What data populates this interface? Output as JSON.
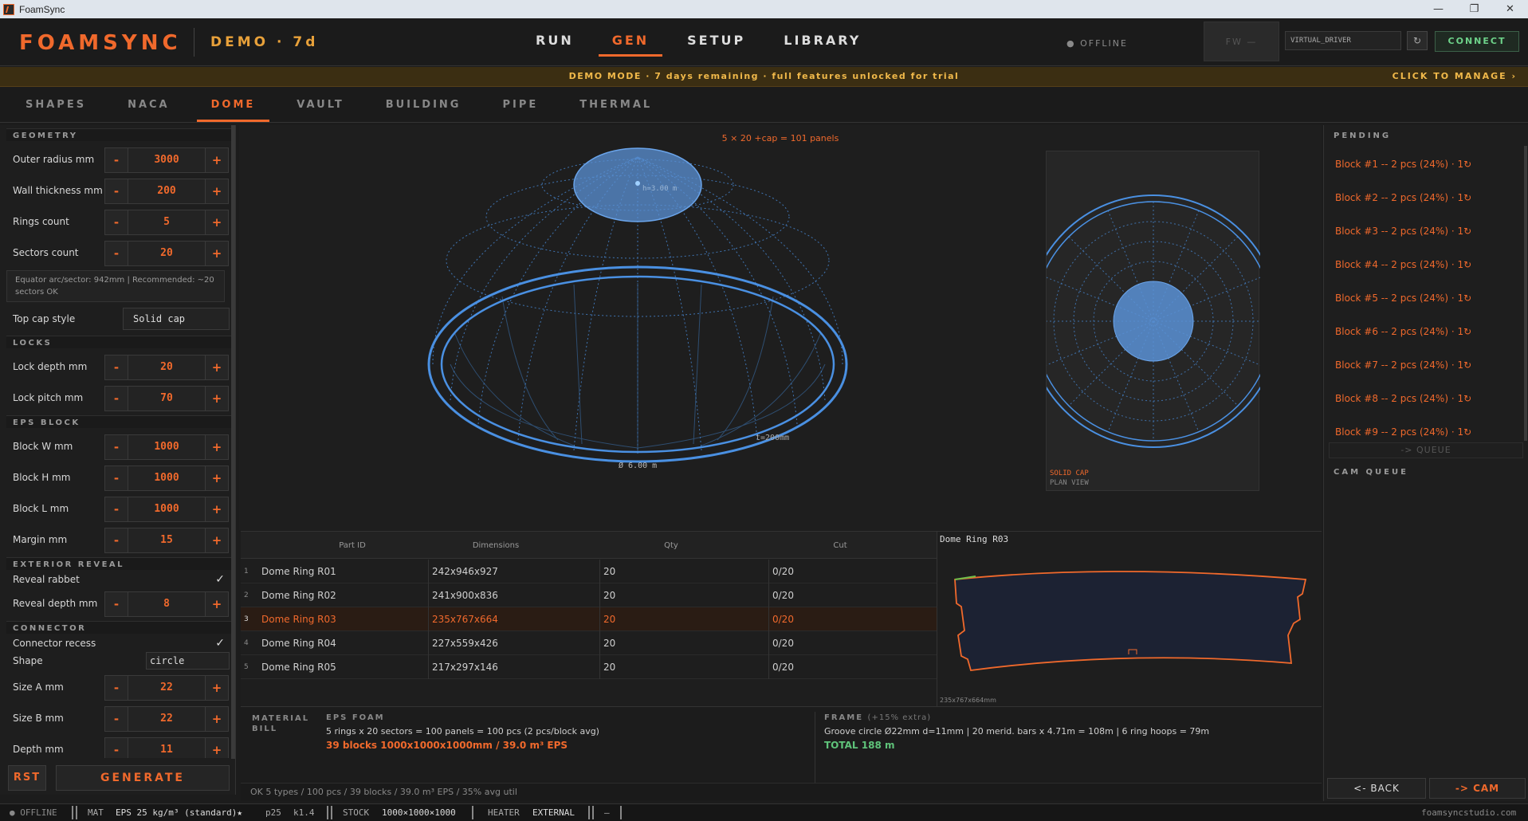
{
  "window": {
    "title": "FoamSync",
    "controls": [
      "—",
      "❐",
      "✕"
    ]
  },
  "header": {
    "logo": "FOAMSYNC",
    "demo": "DEMO · 7d",
    "nav": [
      "RUN",
      "GEN",
      "SETUP",
      "LIBRARY"
    ],
    "active_nav": "GEN",
    "status": "● OFFLINE",
    "fw": "FW —",
    "driver": "VIRTUAL_DRIVER",
    "refresh_icon": "↻",
    "connect": "CONNECT"
  },
  "banner": {
    "message": "DEMO MODE · 7 days remaining · full features unlocked for trial",
    "manage": "CLICK TO MANAGE ›"
  },
  "subtabs": [
    "SHAPES",
    "NACA",
    "DOME",
    "VAULT",
    "BUILDING",
    "PIPE",
    "THERMAL"
  ],
  "active_subtab": "DOME",
  "left": {
    "sections": {
      "geometry": "GEOMETRY",
      "locks": "LOCKS",
      "eps": "EPS BLOCK",
      "exterior": "EXTERIOR REVEAL",
      "connector": "CONNECTOR"
    },
    "minus": "-",
    "plus": "+",
    "outer_radius": {
      "label": "Outer radius mm",
      "value": "3000"
    },
    "wall_thickness": {
      "label": "Wall thickness mm",
      "value": "200"
    },
    "rings": {
      "label": "Rings count",
      "value": "5"
    },
    "sectors": {
      "label": "Sectors count",
      "value": "20"
    },
    "note": "Equator arc/sector: 942mm | Recommended: ~20 sectors OK",
    "top_cap": {
      "label": "Top cap style",
      "value": "Solid cap"
    },
    "lock_depth": {
      "label": "Lock depth mm",
      "value": "20"
    },
    "lock_pitch": {
      "label": "Lock pitch mm",
      "value": "70"
    },
    "block_w": {
      "label": "Block W mm",
      "value": "1000"
    },
    "block_h": {
      "label": "Block H mm",
      "value": "1000"
    },
    "block_l": {
      "label": "Block L mm",
      "value": "1000"
    },
    "margin": {
      "label": "Margin mm",
      "value": "15"
    },
    "reveal_rabbet": {
      "label": "Reveal rabbet",
      "check": "✓"
    },
    "reveal_depth": {
      "label": "Reveal depth mm",
      "value": "8"
    },
    "connector_recess": {
      "label": "Connector recess",
      "check": "✓"
    },
    "shape": {
      "label": "Shape",
      "value": "circle"
    },
    "size_a": {
      "label": "Size A mm",
      "value": "22"
    },
    "size_b": {
      "label": "Size B mm",
      "value": "22"
    },
    "depth": {
      "label": "Depth mm",
      "value": "11"
    },
    "rst": "RST",
    "generate": "GENERATE"
  },
  "viewport": {
    "panel_count": "5 × 20 +cap = 101 panels",
    "cap_height": "h=3.00 m",
    "diameter": "Ø 6.00 m",
    "thickness": "t=200mm",
    "plan_label1": "SOLID CAP",
    "plan_label2": "PLAN VIEW"
  },
  "table": {
    "headers": [
      "Part ID",
      "Dimensions",
      "Qty",
      "Cut"
    ],
    "rows": [
      {
        "idx": "1",
        "id": "Dome Ring R01",
        "dim": "242x946x927",
        "qty": "20",
        "cut": "0/20"
      },
      {
        "idx": "2",
        "id": "Dome Ring R02",
        "dim": "241x900x836",
        "qty": "20",
        "cut": "0/20"
      },
      {
        "idx": "3",
        "id": "Dome Ring R03",
        "dim": "235x767x664",
        "qty": "20",
        "cut": "0/20"
      },
      {
        "idx": "4",
        "id": "Dome Ring R04",
        "dim": "227x559x426",
        "qty": "20",
        "cut": "0/20"
      },
      {
        "idx": "5",
        "id": "Dome Ring R05",
        "dim": "217x297x146",
        "qty": "20",
        "cut": "0/20"
      }
    ],
    "selected": 2
  },
  "preview": {
    "title": "Dome Ring R03",
    "dims": "235x767x664mm"
  },
  "bill": {
    "label": "MATERIAL BILL",
    "eps_head": "EPS FOAM",
    "eps_line1": "5 rings x 20 sectors = 100 panels = 100 pcs (2 pcs/block avg)",
    "eps_line2": "39 blocks 1000x1000x1000mm / 39.0 m³ EPS",
    "frame_head": "FRAME",
    "frame_extra": "(+15% extra)",
    "frame_line1": "Groove circle Ø22mm d=11mm | 20 merid. bars x 4.71m = 108m | 6 ring hoops = 79m",
    "frame_total": "TOTAL 188 m"
  },
  "mini_status": "OK 5 types / 100 pcs / 39 blocks / 39.0 m³ EPS / 35% avg util",
  "right": {
    "pending": "PENDING",
    "items": [
      "Block #1 -- 2 pcs (24%) · 1↻",
      "Block #2 -- 2 pcs (24%) · 1↻",
      "Block #3 -- 2 pcs (24%) · 1↻",
      "Block #4 -- 2 pcs (24%) · 1↻",
      "Block #5 -- 2 pcs (24%) · 1↻",
      "Block #6 -- 2 pcs (24%) · 1↻",
      "Block #7 -- 2 pcs (24%) · 1↻",
      "Block #8 -- 2 pcs (24%) · 1↻",
      "Block #9 -- 2 pcs (24%) · 1↻"
    ],
    "queue": "-> QUEUE",
    "cam_queue": "CAM QUEUE",
    "back": "<- BACK",
    "cam": "-> CAM"
  },
  "statusbar": {
    "offline": "● OFFLINE",
    "mat": "MAT",
    "eps": "EPS 25 kg/m³ (standard)★",
    "p": "p25",
    "k": "k1.4",
    "stock_l": "STOCK",
    "stock": "1000×1000×1000",
    "heater_l": "HEATER",
    "heater": "EXTERNAL",
    "dash": "—",
    "site": "foamsyncstudio.com"
  },
  "colors": {
    "accent": "#f0692c",
    "warning": "#f1b94a",
    "ok": "#5fc37a",
    "wire": "#4a90e2"
  }
}
